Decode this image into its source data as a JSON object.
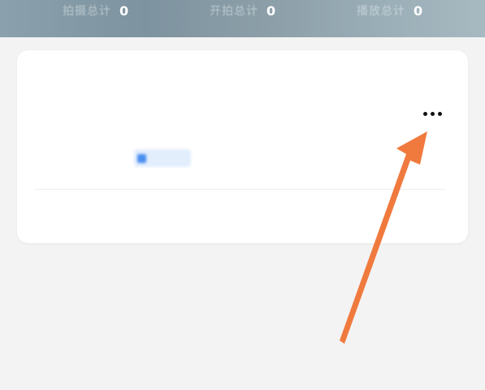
{
  "stats": [
    {
      "label": "拍摄总计",
      "value": "0"
    },
    {
      "label": "开拍总计",
      "value": "0"
    },
    {
      "label": "播放总计",
      "value": "0"
    }
  ],
  "card": {
    "thumbnail_text_line1": "",
    "thumbnail_text_line2": "",
    "title": "",
    "subtitle": "",
    "tag_label": "",
    "footer_left": "",
    "footer_right": ""
  },
  "more_button": {
    "icon": "more-horizontal-icon"
  },
  "colors": {
    "header_gradient_start": "#8aa1ad",
    "header_gradient_end": "#a7b9c1",
    "background": "#f3f3f4",
    "card": "#ffffff",
    "annotation_arrow": "#f07a3e",
    "tag_accent": "#4a8ef0"
  }
}
